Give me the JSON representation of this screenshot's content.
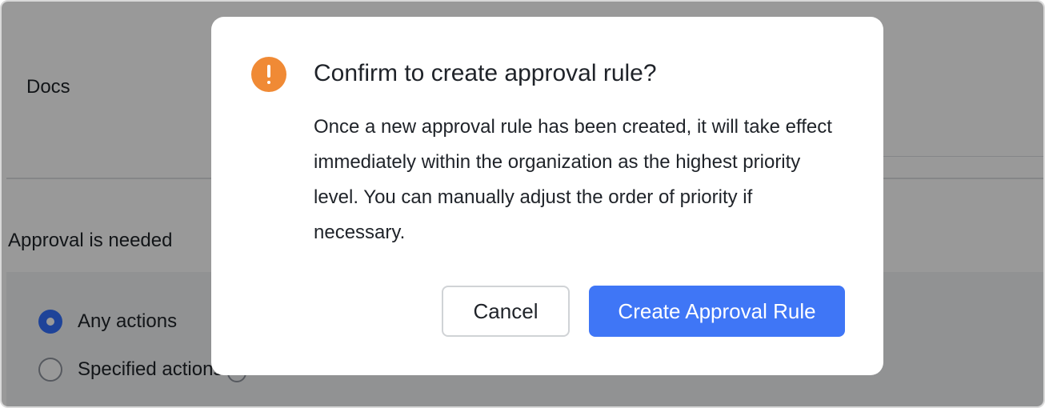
{
  "background": {
    "docs_label": "Docs",
    "approval_label": "Approval is needed",
    "options": [
      {
        "label": "Any actions",
        "checked": true
      },
      {
        "label": "Specified actions",
        "checked": false
      }
    ]
  },
  "dialog": {
    "icon": "warning-icon",
    "title": "Confirm to create approval rule?",
    "body": "Once a new approval rule has been created, it will take effect immediately within the organization as the highest priority level. You can manually adjust the order of priority if necessary.",
    "cancel_label": "Cancel",
    "confirm_label": "Create Approval Rule"
  },
  "colors": {
    "primary": "#3f76f6",
    "warning": "#f08a35"
  }
}
